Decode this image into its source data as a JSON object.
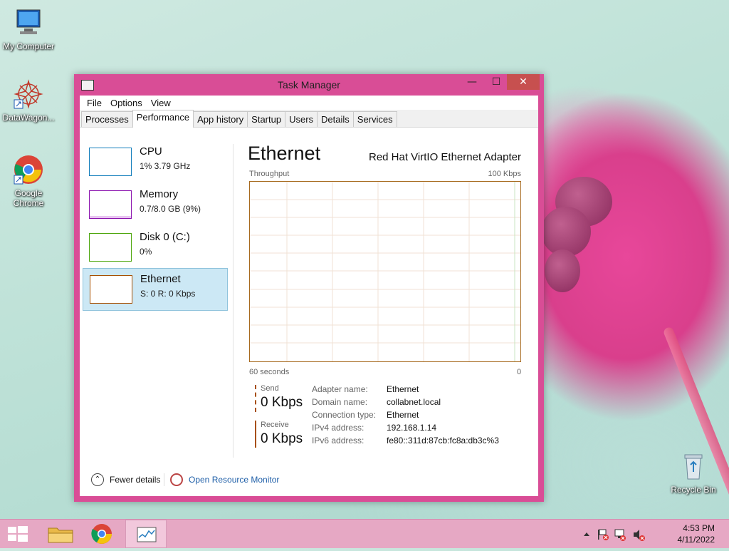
{
  "desktop": {
    "icons": [
      {
        "label": "My Computer"
      },
      {
        "label": "DataWagon..."
      },
      {
        "label": "Google Chrome"
      },
      {
        "label": "Recycle Bin"
      }
    ]
  },
  "window": {
    "title": "Task Manager",
    "controls": {
      "minimize": "—",
      "maximize": "☐",
      "close": "✕"
    },
    "menu": [
      "File",
      "Options",
      "View"
    ],
    "tabs": [
      "Processes",
      "Performance",
      "App history",
      "Startup",
      "Users",
      "Details",
      "Services"
    ],
    "active_tab": "Performance"
  },
  "sidebar": {
    "items": [
      {
        "name": "CPU",
        "value": "1% 3.79 GHz",
        "color": "#117dbb"
      },
      {
        "name": "Memory",
        "value": "0.7/8.0 GB (9%)",
        "color": "#8b12ae"
      },
      {
        "name": "Disk 0 (C:)",
        "value": "0%",
        "color": "#4da60c"
      },
      {
        "name": "Ethernet",
        "value": "S: 0 R: 0 Kbps",
        "color": "#a74f01",
        "selected": true
      }
    ]
  },
  "main": {
    "title": "Ethernet",
    "adapter": "Red Hat VirtIO Ethernet Adapter",
    "graph": {
      "top_left": "Throughput",
      "top_right": "100 Kbps",
      "bottom_left": "60 seconds",
      "bottom_right": "0"
    },
    "send": {
      "label": "Send",
      "value": "0 Kbps"
    },
    "receive": {
      "label": "Receive",
      "value": "0 Kbps"
    },
    "info": [
      {
        "key": "Adapter name:",
        "value": "Ethernet"
      },
      {
        "key": "Domain name:",
        "value": "collabnet.local"
      },
      {
        "key": "Connection type:",
        "value": "Ethernet"
      },
      {
        "key": "IPv4 address:",
        "value": "192.168.1.14"
      },
      {
        "key": "IPv6 address:",
        "value": "fe80::311d:87cb:fc8a:db3c%3"
      }
    ]
  },
  "footer": {
    "fewer_details": "Fewer details",
    "open_monitor": "Open Resource Monitor"
  },
  "taskbar": {
    "clock_time": "4:53 PM",
    "clock_date": "4/11/2022",
    "apps": [
      "start",
      "file-explorer",
      "chrome",
      "task-manager"
    ]
  }
}
